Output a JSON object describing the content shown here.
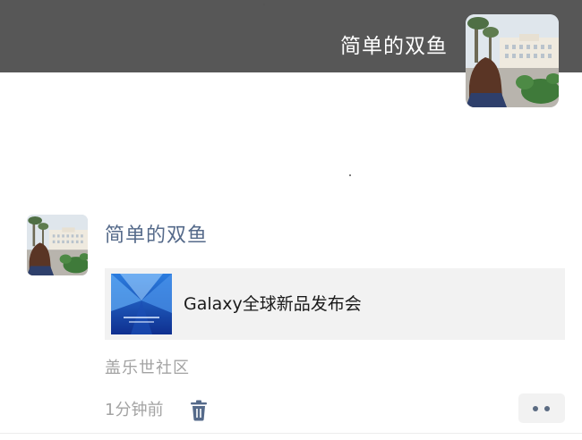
{
  "profile": {
    "nickname": "简单的双鱼",
    "avatar": "avatar-photo-girl-in-front-of-building"
  },
  "post": {
    "author": "简单的双鱼",
    "link": {
      "title": "Galaxy全球新品发布会",
      "thumbnail": "galaxy-launch-event-thumbnail"
    },
    "source": "盖乐世社区",
    "time": "1分钟前",
    "delete_icon": "trash-icon",
    "more_icon": "more-dots-icon"
  },
  "colors": {
    "cover": "#575757",
    "author_name": "#556a8a",
    "meta_text": "#a3a3a3",
    "card_bg": "#f2f2f2"
  }
}
